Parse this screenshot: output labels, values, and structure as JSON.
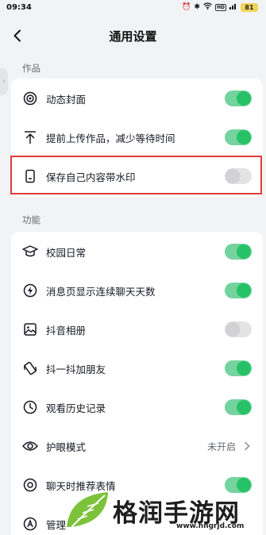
{
  "status_bar": {
    "time": "09:34",
    "battery": "81",
    "hd": "HD"
  },
  "header": {
    "title": "通用设置"
  },
  "sections": [
    {
      "label": "作品",
      "rows": [
        {
          "icon": "dynamic-cover-icon",
          "label": "动态封面",
          "control": "toggle",
          "state": "on"
        },
        {
          "icon": "upload-arrow-icon",
          "label": "提前上传作品，减少等待时间",
          "control": "toggle",
          "state": "on"
        },
        {
          "icon": "phone-watermark-icon",
          "label": "保存自己内容带水印",
          "control": "toggle",
          "state": "off"
        }
      ]
    },
    {
      "label": "功能",
      "rows": [
        {
          "icon": "graduation-cap-icon",
          "label": "校园日常",
          "control": "toggle",
          "state": "on"
        },
        {
          "icon": "lightning-icon",
          "label": "消息页显示连续聊天天数",
          "control": "toggle",
          "state": "on"
        },
        {
          "icon": "image-album-icon",
          "label": "抖音相册",
          "control": "toggle",
          "state": "off"
        },
        {
          "icon": "shake-phone-icon",
          "label": "抖一抖加朋友",
          "control": "toggle",
          "state": "on"
        },
        {
          "icon": "clock-history-icon",
          "label": "观看历史记录",
          "control": "toggle",
          "state": "on"
        },
        {
          "icon": "eye-icon",
          "label": "护眼模式",
          "control": "link",
          "value": "未开启"
        },
        {
          "icon": "chat-sticker-icon",
          "label": "聊天时推荐表情",
          "control": "toggle",
          "state": "on"
        },
        {
          "icon": "manage-icon",
          "label": "管理",
          "control": "none"
        }
      ]
    }
  ],
  "watermark": {
    "text": "格润手游网",
    "url": "www.hngrjd.com"
  },
  "colors": {
    "toggle_on": "#27c267",
    "toggle_off": "#d2d2d5",
    "highlight": "#e23b3b",
    "background": "#f2f3f5"
  }
}
